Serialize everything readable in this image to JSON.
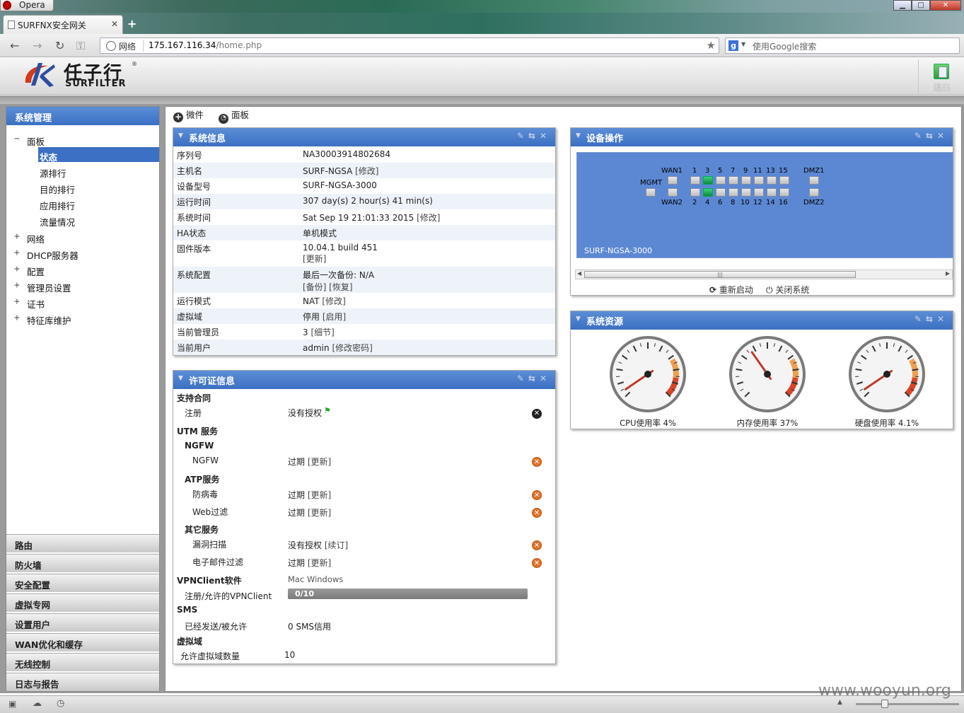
{
  "browser": {
    "app_name": "Opera",
    "tab_title": "SURFNX安全网关",
    "site_label": "网络",
    "url_host": "175.167.116.34",
    "url_path": "/home.php",
    "search_placeholder": "使用Google搜索",
    "search_engine_glyph": "g"
  },
  "header": {
    "logo_cn": "任子行",
    "logo_en": "SURFILTER",
    "logo_reg": "®",
    "logout_label": "退出"
  },
  "sidebar": {
    "title": "系统管理",
    "tree": {
      "panel": {
        "label": "面板",
        "toggle": "−"
      },
      "panel_children": [
        "状态",
        "源排行",
        "目的排行",
        "应用排行",
        "流量情况"
      ],
      "items": [
        {
          "label": "网络",
          "toggle": "+"
        },
        {
          "label": "DHCP服务器",
          "toggle": "+"
        },
        {
          "label": "配置",
          "toggle": "+"
        },
        {
          "label": "管理员设置",
          "toggle": "+"
        },
        {
          "label": "证书",
          "toggle": "+"
        },
        {
          "label": "特征库维护",
          "toggle": "+"
        }
      ]
    },
    "sections": [
      "路由",
      "防火墙",
      "安全配置",
      "虚拟专网",
      "设置用户",
      "WAN优化和缓存",
      "无线控制",
      "日志与报告"
    ]
  },
  "toolbar": {
    "widget_label": "微件",
    "dashboard_label": "面板"
  },
  "system_info": {
    "title": "系统信息",
    "rows": [
      {
        "k": "序列号",
        "v": "NA30003914802684",
        "link": ""
      },
      {
        "k": "主机名",
        "v": "SURF-NGSA",
        "link": "[修改]"
      },
      {
        "k": "设备型号",
        "v": "SURF-NGSA-3000",
        "link": ""
      },
      {
        "k": "运行时间",
        "v": "307 day(s) 2 hour(s) 41 min(s)",
        "link": ""
      },
      {
        "k": "系统时间",
        "v": "Sat Sep 19 21:01:33 2015",
        "link": "[修改]"
      },
      {
        "k": "HA状态",
        "v": "单机模式",
        "link": ""
      },
      {
        "k": "固件版本",
        "v": "10.04.1 build 451",
        "link": "[更新]"
      },
      {
        "k": "系统配置",
        "v": "最后一次备份: N/A",
        "link": "[备份] [恢复]"
      },
      {
        "k": "运行模式",
        "v": "NAT",
        "link": "[修改]"
      },
      {
        "k": "虚拟域",
        "v": "停用",
        "link": "[启用]"
      },
      {
        "k": "当前管理员",
        "v": "3",
        "link": "[细节]"
      },
      {
        "k": "当前用户",
        "v": "admin",
        "link": "[修改密码]"
      }
    ]
  },
  "license": {
    "title": "许可证信息",
    "support_contract": "支持合同",
    "register": {
      "label": "注册",
      "value": "没有授权"
    },
    "utm": "UTM 服务",
    "ngfw_group": "NGFW",
    "ngfw": {
      "label": "NGFW",
      "value": "过期",
      "link": "[更新]"
    },
    "atp_group": "ATP服务",
    "antivirus": {
      "label": "防病毒",
      "value": "过期",
      "link": "[更新]"
    },
    "webfilter": {
      "label": "Web过滤",
      "value": "过期",
      "link": "[更新]"
    },
    "other_group": "其它服务",
    "vulnscan": {
      "label": "漏洞扫描",
      "value": "没有授权",
      "link": "[续订]"
    },
    "mailfilter": {
      "label": "电子邮件过滤",
      "value": "过期",
      "link": "[更新]"
    },
    "vpn_client": "VPNClient软件",
    "vpn_platforms": "Mac Windows",
    "vpn_reg_label": "注册/允许的VPNClient",
    "vpn_reg_value": "0/10",
    "vpn_reg_fraction": 0,
    "sms": "SMS",
    "sms_label": "已经发送/被允许",
    "sms_value": "0 SMS信用",
    "vdom": "虚拟域",
    "vdom_label": "允许虚拟域数量",
    "vdom_value": "10"
  },
  "device_ops": {
    "title": "设备操作",
    "model": "SURF-NGSA-3000",
    "labels": {
      "mgmt": "MGMT",
      "wan1": "WAN1",
      "wan2": "WAN2",
      "dmz1": "DMZ1",
      "dmz2": "DMZ2"
    },
    "top_ports": [
      "1",
      "3",
      "5",
      "7",
      "9",
      "11",
      "13",
      "15"
    ],
    "bottom_ports": [
      "2",
      "4",
      "6",
      "8",
      "10",
      "12",
      "14",
      "16"
    ],
    "active_ports": [
      "3",
      "4"
    ],
    "reboot_label": "重新启动",
    "shutdown_label": "关闭系统"
  },
  "resources": {
    "title": "系统资源",
    "gauges": [
      {
        "label": "CPU使用率 4%",
        "value": 4
      },
      {
        "label": "内存使用率 37%",
        "value": 37
      },
      {
        "label": "硬盘使用率 4.1%",
        "value": 4.1
      }
    ]
  },
  "watermark": "www.wooyun.org",
  "colors": {
    "accent": "#3b70c4",
    "panel_header": "#4a7ed0",
    "error": "#e0722a"
  }
}
